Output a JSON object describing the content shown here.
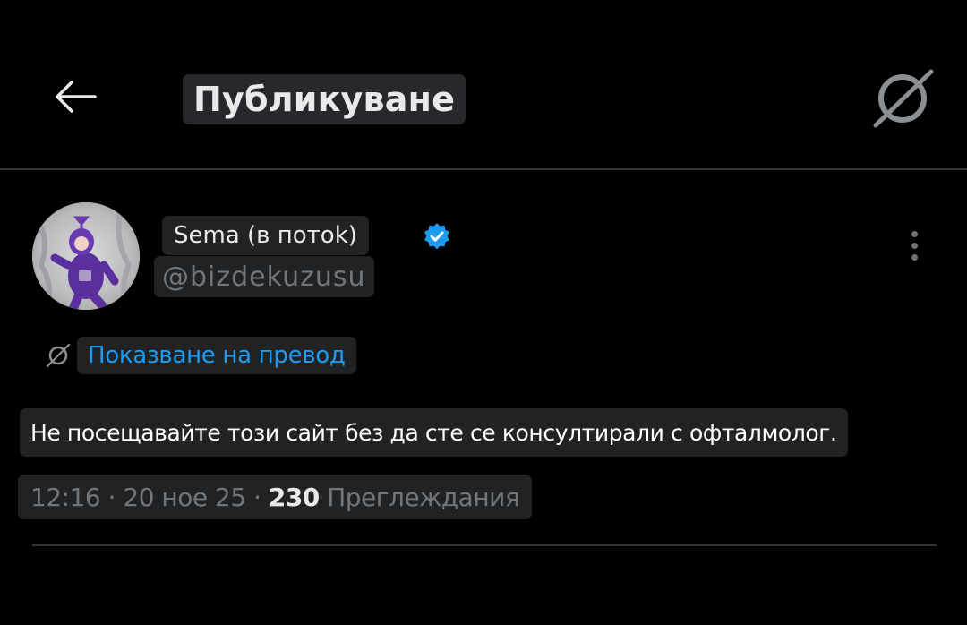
{
  "header": {
    "title": "Публикуване",
    "back_icon": "arrow-left-icon",
    "translate_icon": "translate-icon"
  },
  "author": {
    "display_name": "Sema (в потоk)",
    "handle": "@bizdekuzusu",
    "verified": true,
    "verified_color": "#1d9bf0",
    "avatar_icon": "avatar-image",
    "more_icon": "more-vertical-icon"
  },
  "translate": {
    "label": "Показване на превод",
    "icon": "translate-icon",
    "color": "#1d9bf0"
  },
  "post": {
    "text": "Не посещавайте този сайт без да сте се консултирали с офталмолог."
  },
  "meta": {
    "time": "12:16",
    "sep1": " · ",
    "date": "20 ное 25",
    "sep2": " · ",
    "views_count": "230",
    "views_label": " Преглеждания"
  },
  "colors": {
    "background": "#000000",
    "text_primary": "#e7e9ea",
    "text_secondary": "#71767b",
    "accent": "#1d9bf0",
    "divider": "#2f3336"
  }
}
